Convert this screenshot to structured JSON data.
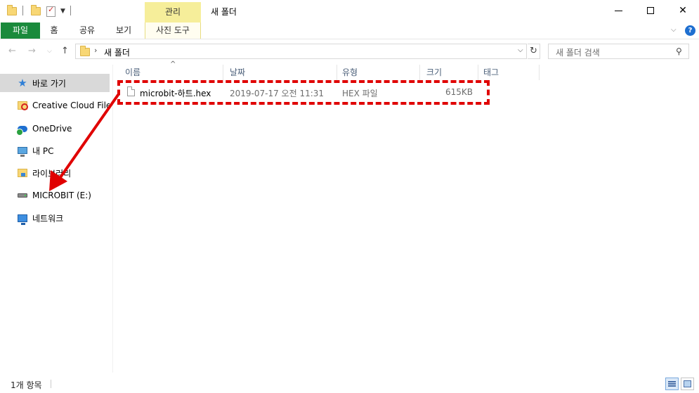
{
  "window": {
    "title": "새 폴더",
    "context_tab": "관리",
    "controls": {
      "minimize": "minimize-icon",
      "maximize": "maximize-icon",
      "close": "✕"
    }
  },
  "ribbon": {
    "tabs": [
      {
        "label": "파일"
      },
      {
        "label": "홈"
      },
      {
        "label": "공유"
      },
      {
        "label": "보기"
      },
      {
        "label": "사진 도구"
      }
    ],
    "help": "?"
  },
  "address": {
    "path": "새 폴더",
    "separator": "›"
  },
  "search": {
    "placeholder": "새 폴더 검색"
  },
  "navigation": {
    "items": [
      {
        "label": "바로 가기",
        "icon": "star-icon"
      },
      {
        "label": "Creative Cloud Files",
        "icon": "creative-cloud-folder-icon"
      },
      {
        "label": "OneDrive",
        "icon": "onedrive-icon"
      },
      {
        "label": "내 PC",
        "icon": "pc-icon"
      },
      {
        "label": "라이브러리",
        "icon": "library-icon"
      },
      {
        "label": "MICROBIT (E:)",
        "icon": "drive-icon"
      },
      {
        "label": "네트워크",
        "icon": "network-icon"
      }
    ]
  },
  "file_list": {
    "columns": [
      {
        "label": "이름"
      },
      {
        "label": "날짜"
      },
      {
        "label": "유형"
      },
      {
        "label": "크기"
      },
      {
        "label": "태그"
      }
    ],
    "rows": [
      {
        "name": "microbit-하트.hex",
        "date": "2019-07-17 오전 11:31",
        "type": "HEX 파일",
        "size": "615KB"
      }
    ]
  },
  "annotations": {
    "highlight_color": "#e00000",
    "arrow_color": "#e00000"
  },
  "status": {
    "item_count": "1개 항목"
  },
  "colors": {
    "file_tab": "#1a8a3c",
    "context_tab": "#f6ee9a",
    "nav_selected": "#d9d9d9",
    "help": "#1e6fd0"
  }
}
